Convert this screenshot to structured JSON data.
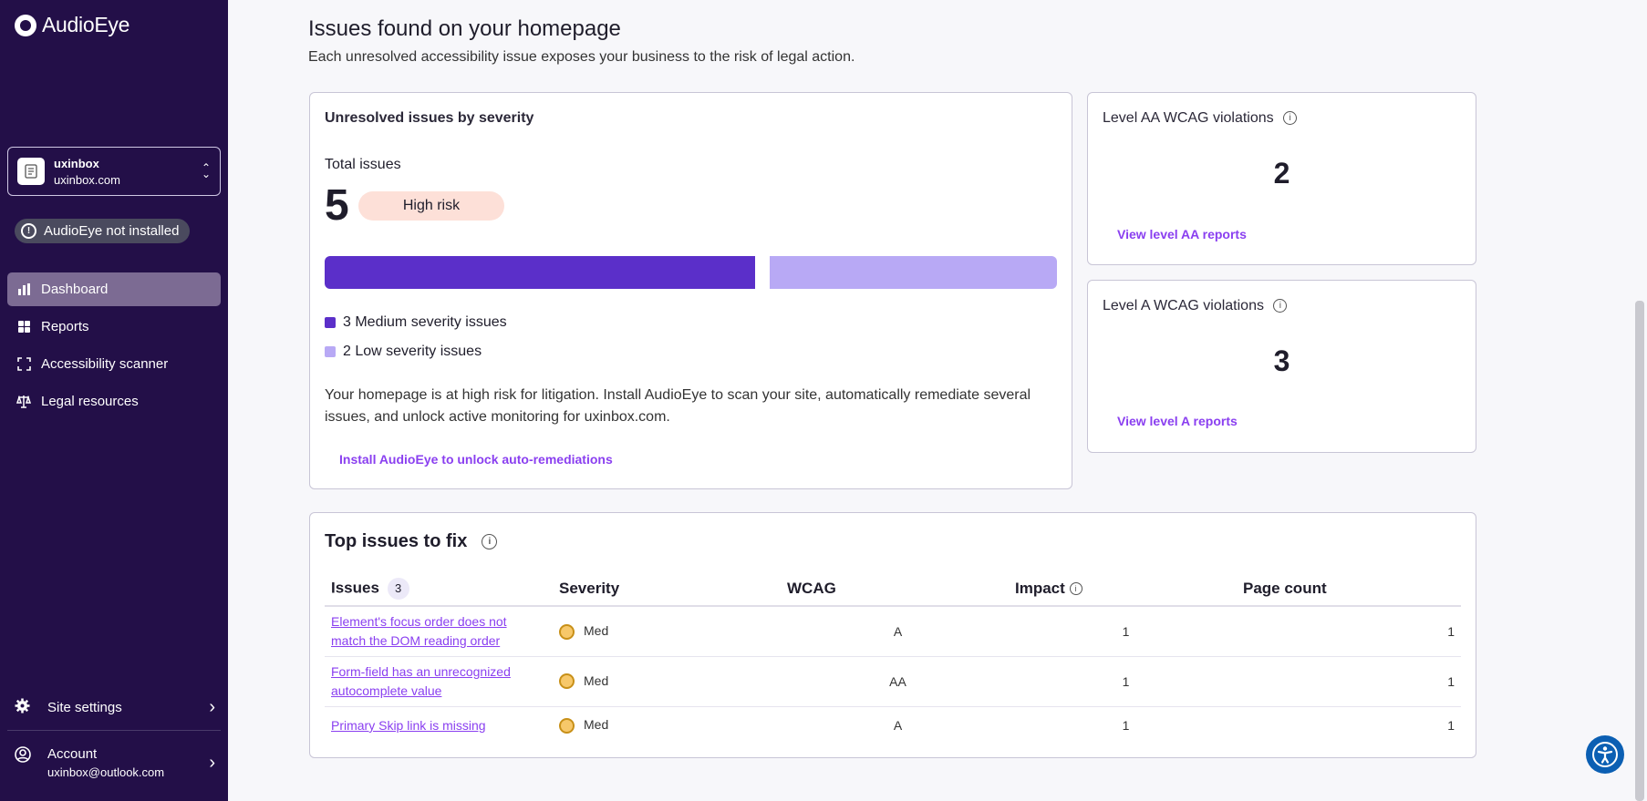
{
  "app": {
    "logo_text": "AudioEye"
  },
  "site": {
    "name": "uxinbox",
    "domain": "uxinbox.com"
  },
  "status_badge": "AudioEye not installed",
  "nav": [
    {
      "label": "Dashboard",
      "icon": "bar-chart-icon",
      "active": true
    },
    {
      "label": "Reports",
      "icon": "reports-icon"
    },
    {
      "label": "Accessibility scanner",
      "icon": "scanner-icon"
    },
    {
      "label": "Legal resources",
      "icon": "scale-icon"
    }
  ],
  "bottom": {
    "settings_label": "Site settings",
    "account_label": "Account",
    "account_email": "uxinbox@outlook.com"
  },
  "page": {
    "title": "Issues found on your homepage",
    "subtitle": "Each unresolved accessibility issue exposes your business to the risk of legal action."
  },
  "severity_card": {
    "title": "Unresolved issues by severity",
    "total_label": "Total issues",
    "total": "5",
    "risk_label": "High risk",
    "medium_count": 3,
    "low_count": 2,
    "legend_medium": "3 Medium severity issues",
    "legend_low": "2 Low severity issues",
    "description": "Your homepage is at high risk for litigation. Install AudioEye to scan your site, automatically remediate several issues, and unlock active monitoring for uxinbox.com.",
    "install_link": "Install AudioEye to unlock auto-remediations",
    "colors": {
      "medium": "#5b2fc9",
      "low": "#b8a9f5",
      "risk_bg": "#fde0d8"
    }
  },
  "aa_card": {
    "title": "Level AA WCAG violations",
    "value": "2",
    "link": "View level AA reports"
  },
  "a_card": {
    "title": "Level A WCAG violations",
    "value": "3",
    "link": "View level A reports"
  },
  "top_issues": {
    "title": "Top issues to fix",
    "headers": {
      "issues": "Issues",
      "issues_count": "3",
      "severity": "Severity",
      "wcag": "WCAG",
      "impact": "Impact",
      "page_count": "Page count"
    },
    "rows": [
      {
        "issue": "Element's focus order does not match the DOM reading order",
        "severity": "Med",
        "wcag": "A",
        "impact": "1",
        "page_count": "1"
      },
      {
        "issue": "Form-field has an unrecognized autocomplete value",
        "severity": "Med",
        "wcag": "AA",
        "impact": "1",
        "page_count": "1"
      },
      {
        "issue": "Primary Skip link is missing",
        "severity": "Med",
        "wcag": "A",
        "impact": "1",
        "page_count": "1"
      }
    ]
  }
}
